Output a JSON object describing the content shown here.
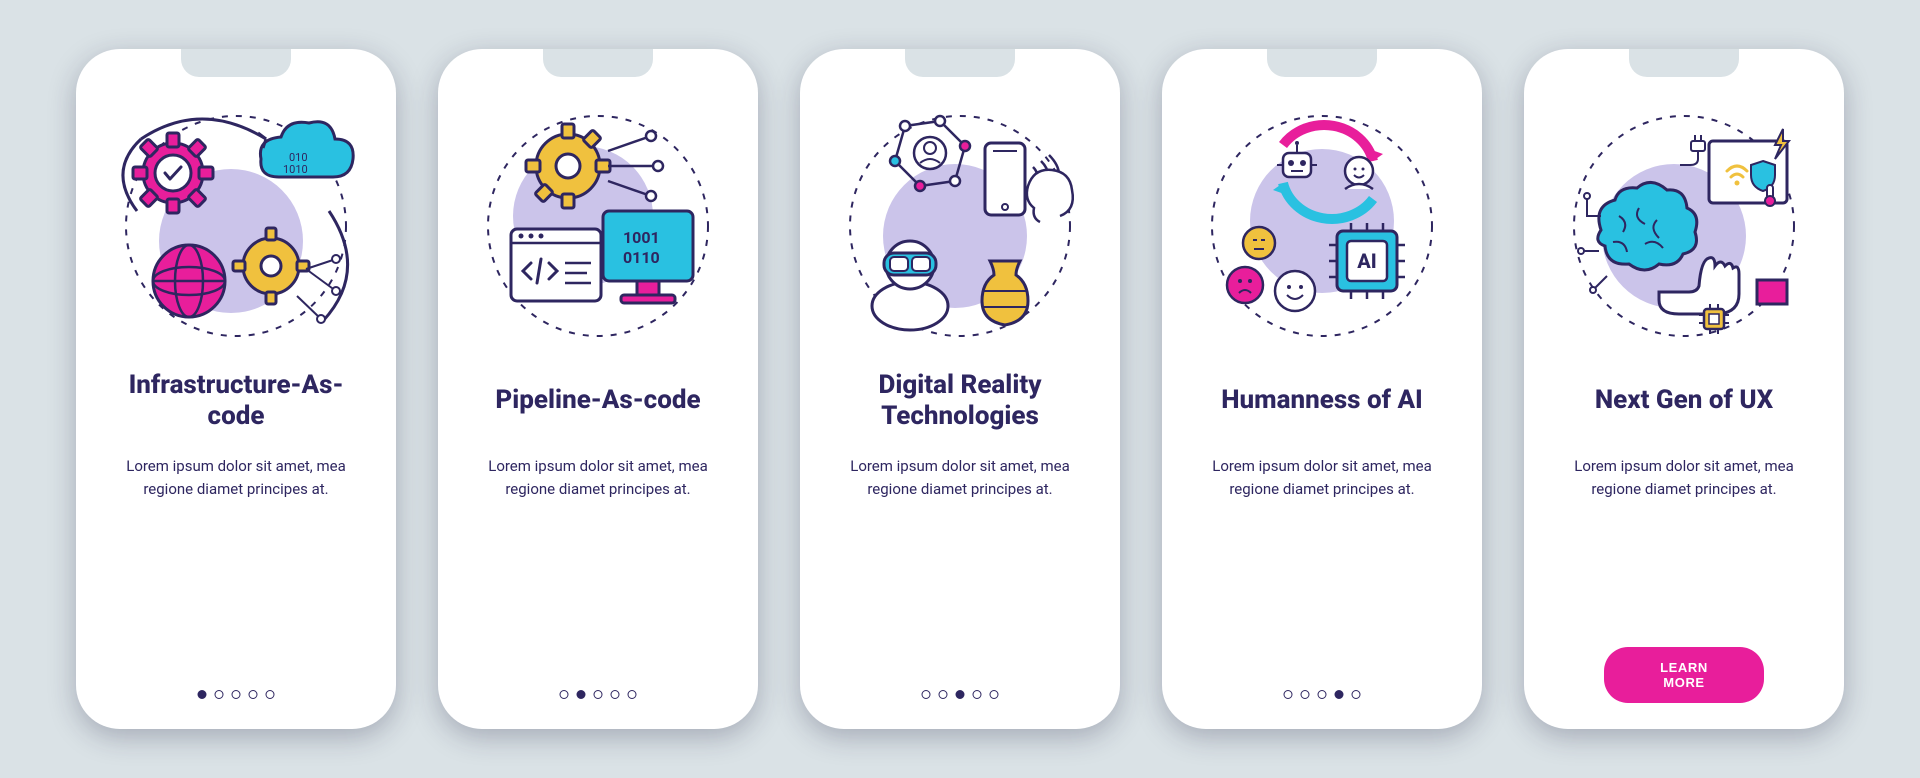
{
  "colors": {
    "bg": "#dae2e6",
    "card": "#ffffff",
    "text": "#2e2660",
    "accentPink": "#e81e9b",
    "accentBlue": "#29c1e1",
    "accentYellow": "#f0c13e",
    "accentLavender": "#cbc4ea",
    "dashed": "#2e2660"
  },
  "lorem": "Lorem ipsum dolor sit amet, mea regione diamet principes at.",
  "cards": [
    {
      "title": "Infrastructure-As-code",
      "desc_ref": "lorem",
      "icon": "infra-as-code",
      "activeDot": 0,
      "hasCta": false
    },
    {
      "title": "Pipeline-As-code",
      "desc_ref": "lorem",
      "icon": "pipeline-as-code",
      "activeDot": 1,
      "hasCta": false
    },
    {
      "title": "Digital Reality Technologies",
      "desc_ref": "lorem",
      "icon": "digital-reality",
      "activeDot": 2,
      "hasCta": false
    },
    {
      "title": "Humanness of AI",
      "desc_ref": "lorem",
      "icon": "humanness-ai",
      "activeDot": 3,
      "hasCta": false
    },
    {
      "title": "Next Gen of UX",
      "desc_ref": "lorem",
      "icon": "next-gen-ux",
      "activeDot": 4,
      "hasCta": true
    }
  ],
  "cta_label": "LEARN MORE",
  "dot_count": 5,
  "illus_text": {
    "binary1": "010",
    "binary2": "1010",
    "binary3": "1001",
    "binary4": "0110",
    "ai_label": "AI"
  }
}
